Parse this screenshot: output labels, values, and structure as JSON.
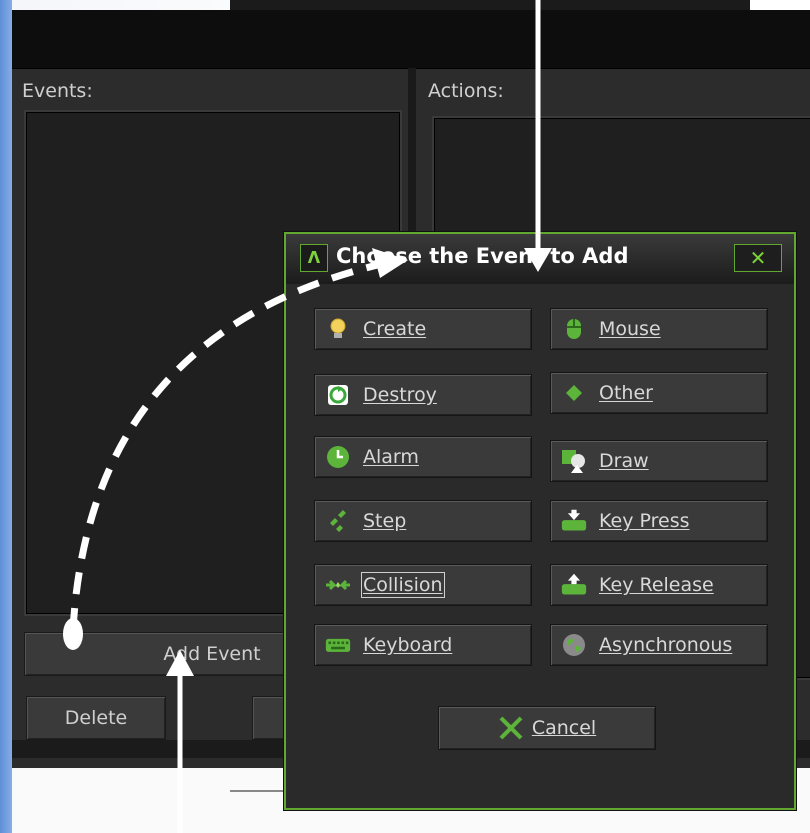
{
  "base": {
    "events_label": "Events:",
    "actions_label": "Actions:",
    "add_event_button": "Add Event",
    "delete_button": "Delete"
  },
  "dialog": {
    "title": "Choose the Event to Add",
    "close_icon": "close-icon",
    "events_left": [
      {
        "label": "Create",
        "icon": "lightbulb-icon"
      },
      {
        "label": "Destroy",
        "icon": "recycle-icon"
      },
      {
        "label": "Alarm",
        "icon": "clock-icon"
      },
      {
        "label": "Step",
        "icon": "step-icon"
      },
      {
        "label": "Collision",
        "icon": "collision-icon"
      },
      {
        "label": "Keyboard",
        "icon": "keyboard-icon"
      }
    ],
    "events_right": [
      {
        "label": "Mouse",
        "icon": "mouse-icon"
      },
      {
        "label": "Other",
        "icon": "diamond-icon"
      },
      {
        "label": "Draw",
        "icon": "draw-icon"
      },
      {
        "label": "Key Press",
        "icon": "key-press-icon"
      },
      {
        "label": "Key Release",
        "icon": "key-release-icon"
      },
      {
        "label": "Asynchronous",
        "icon": "globe-icon"
      }
    ],
    "cancel_button": "Cancel",
    "cancel_icon": "x-icon"
  },
  "colors": {
    "accent": "#62a830",
    "window_bg": "#2c2c2c",
    "button_bg": "#3a3a3a",
    "annotation": "#ffffff"
  }
}
